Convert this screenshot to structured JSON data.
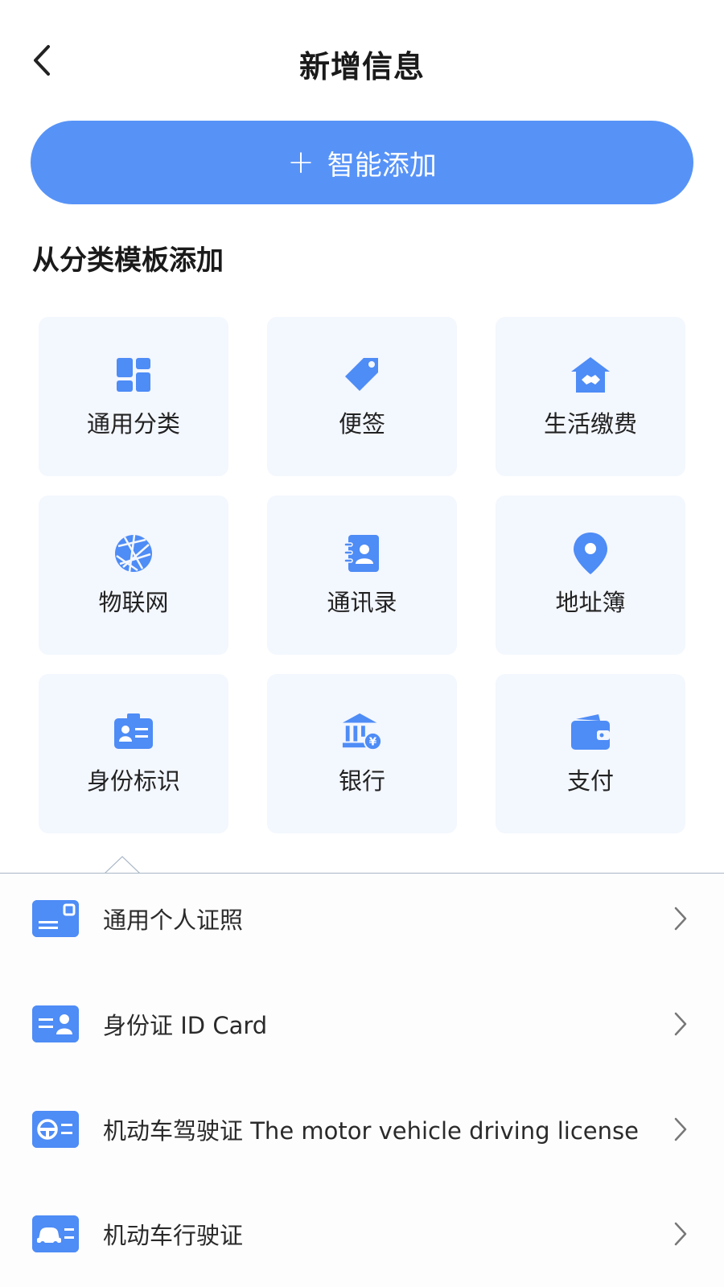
{
  "header": {
    "title": "新增信息",
    "back_icon": "chevron-left-icon"
  },
  "smart_add": {
    "plus": "+",
    "label": "智能添加"
  },
  "section": {
    "title": "从分类模板添加"
  },
  "categories": [
    {
      "label": "通用分类",
      "icon": "grid-layout-icon"
    },
    {
      "label": "便签",
      "icon": "tag-icon"
    },
    {
      "label": "生活缴费",
      "icon": "home-handshake-icon"
    },
    {
      "label": "物联网",
      "icon": "globe-network-icon"
    },
    {
      "label": "通讯录",
      "icon": "contact-book-icon"
    },
    {
      "label": "地址簿",
      "icon": "location-pin-icon"
    },
    {
      "label": "身份标识",
      "icon": "id-badge-icon"
    },
    {
      "label": "银行",
      "icon": "bank-icon"
    },
    {
      "label": "支付",
      "icon": "wallet-icon"
    }
  ],
  "templates": [
    {
      "label": "通用个人证照",
      "icon": "card-icon"
    },
    {
      "label": "身份证 ID Card",
      "icon": "id-card-icon"
    },
    {
      "label": "机动车驾驶证 The motor vehicle driving license",
      "icon": "steering-wheel-card-icon"
    },
    {
      "label": "机动车行驶证",
      "icon": "car-card-icon"
    }
  ],
  "colors": {
    "accent": "#5793f7",
    "icon_blue": "#4e8cf6",
    "tile_bg": "#f3f7fe"
  }
}
